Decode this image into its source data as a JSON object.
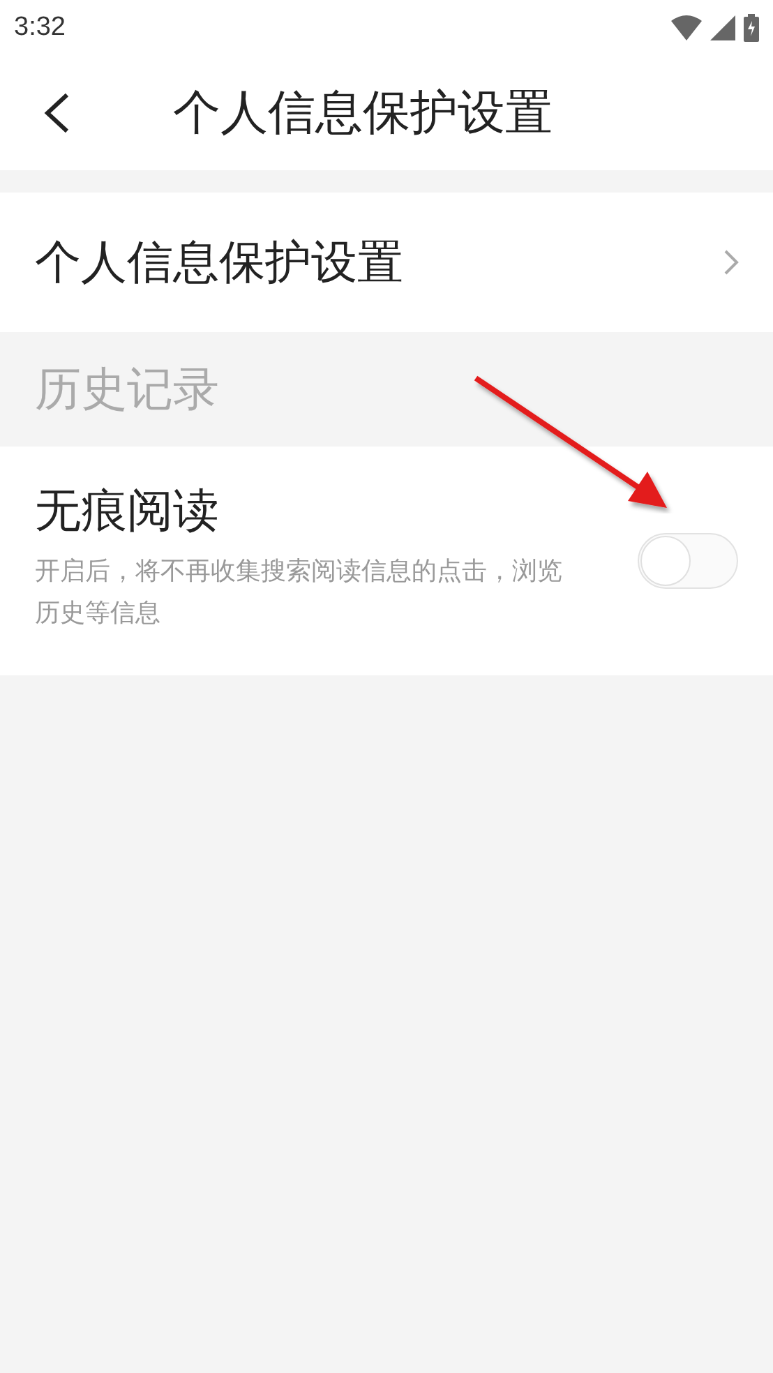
{
  "status_bar": {
    "time": "3:32"
  },
  "header": {
    "title": "个人信息保护设置"
  },
  "sections": [
    {
      "kind": "link",
      "title": "个人信息保护设置"
    },
    {
      "kind": "heading",
      "title": "历史记录"
    },
    {
      "kind": "toggle",
      "title": "无痕阅读",
      "description": "开启后，将不再收集搜索阅读信息的点击，浏览历史等信息",
      "on": false
    }
  ],
  "annotations": [
    {
      "kind": "arrow"
    }
  ]
}
